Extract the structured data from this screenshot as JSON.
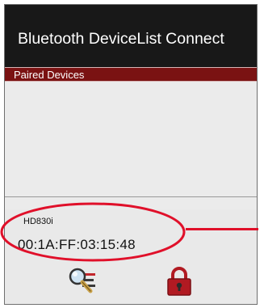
{
  "window": {
    "title": "Bluetooth DeviceList Connect"
  },
  "section": {
    "header": "Paired Devices"
  },
  "devices": [
    {
      "name": "HD830i",
      "mac": "00:1A:FF:03:15:48"
    }
  ],
  "toolbar": {
    "buttons": [
      {
        "icon": "search-icon"
      },
      {
        "icon": "lock-icon"
      }
    ]
  },
  "colors": {
    "title_bar": "#181818",
    "section_header": "#7a1212",
    "highlight": "#e0102a",
    "lock_body": "#b11a22"
  }
}
